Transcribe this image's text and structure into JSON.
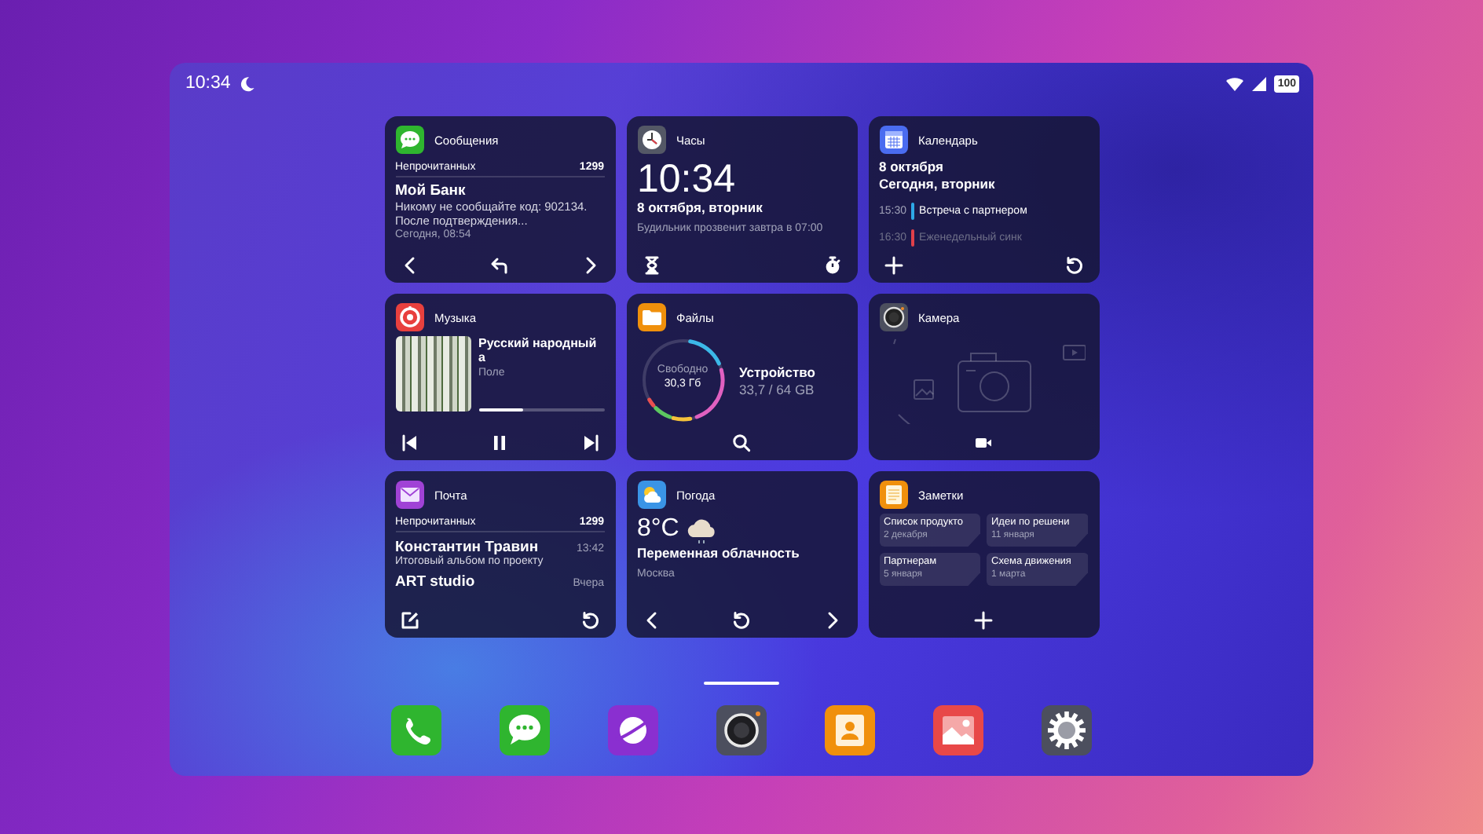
{
  "status_bar": {
    "time": "10:34",
    "battery": "100"
  },
  "widgets": [
    {
      "kind": "messages",
      "title": "Сообщения",
      "unread_label": "Непрочитанных",
      "unread_count": "1299",
      "sender": "Мой Банк",
      "preview": "Никому не сообщайте код: 902134. После подтверждения...",
      "time": "Сегодня, 08:54"
    },
    {
      "kind": "clock",
      "title": "Часы",
      "time": "10:34",
      "date": "8 октября, вторник",
      "alarm": "Будильник прозвенит завтра в 07:00"
    },
    {
      "kind": "calendar",
      "title": "Календарь",
      "date": "8 октября",
      "day": "Сегодня, вторник",
      "events": [
        {
          "time": "15:30",
          "title": "Встреча с партнером",
          "color": "#2ea8e6"
        },
        {
          "time": "16:30",
          "title": "Еженедельный синк",
          "color": "#e0404a"
        }
      ]
    },
    {
      "kind": "music",
      "title": "Музыка",
      "track": "Русский народный а",
      "artist": "Поле",
      "level": 0.36
    },
    {
      "kind": "files",
      "title": "Файлы",
      "free_label": "Свободно",
      "free_value": "30,3 Гб",
      "device": "Устройство",
      "usage": "33,7 / 64 GB"
    },
    {
      "kind": "camera",
      "title": "Камера"
    },
    {
      "kind": "mail",
      "title": "Почта",
      "unread_label": "Непрочитанных",
      "unread_count": "1299",
      "messages": [
        {
          "sender": "Константин Травин",
          "time": "13:42",
          "subject": "Итоговый альбом по проекту"
        },
        {
          "sender": "ART studio",
          "time": "Вчера"
        }
      ]
    },
    {
      "kind": "weather",
      "title": "Погода",
      "temperature": "8°C",
      "condition": "Переменная облачность",
      "city": "Москва"
    },
    {
      "kind": "notes",
      "title": "Заметки",
      "notes": [
        {
          "title": "Список продукто",
          "date": "2 декабря"
        },
        {
          "title": "Идеи по решени",
          "date": "11 января"
        },
        {
          "title": "Партнерам",
          "date": "5 января"
        },
        {
          "title": "Схема движения",
          "date": "1 марта"
        }
      ]
    }
  ],
  "dock": [
    {
      "kind": "phone"
    },
    {
      "kind": "messages"
    },
    {
      "kind": "browser"
    },
    {
      "kind": "camera"
    },
    {
      "kind": "contacts"
    },
    {
      "kind": "gallery"
    },
    {
      "kind": "settings"
    }
  ]
}
